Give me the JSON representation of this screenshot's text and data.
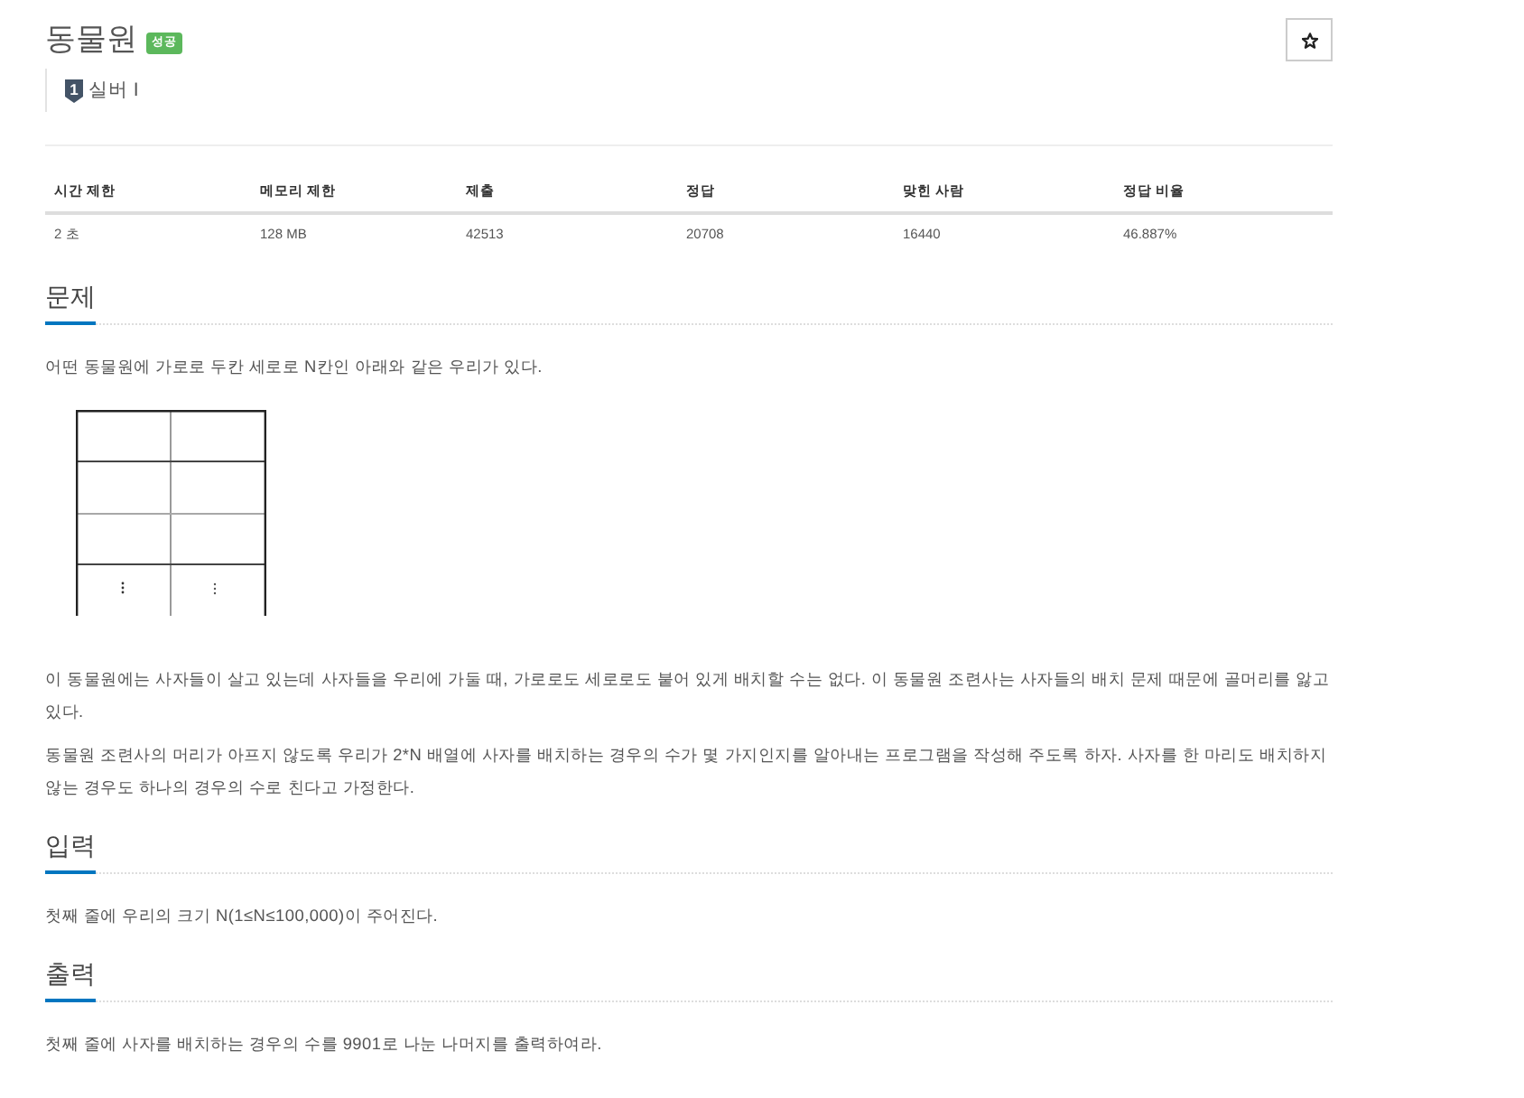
{
  "problem": {
    "title": "동물원",
    "result_badge": "성공",
    "starred": false,
    "tier": {
      "icon_number": "1",
      "label": "실버 I"
    }
  },
  "stats_table": {
    "columns": [
      "시간 제한",
      "메모리 제한",
      "제출",
      "정답",
      "맞힌 사람",
      "정답 비율"
    ],
    "rows": [
      [
        "2 초",
        "128 MB",
        "42513",
        "20708",
        "16440",
        "46.887%"
      ]
    ]
  },
  "sections": [
    {
      "heading": "문제",
      "blocks": [
        {
          "kind": "paragraph",
          "text": "어떤 동물원에 가로로 두칸 세로로 N칸인 아래와 같은 우리가 있다."
        },
        {
          "kind": "cage_diagram"
        },
        {
          "kind": "paragraph",
          "text": "이 동물원에는 사자들이 살고 있는데 사자들을 우리에 가둘 때, 가로로도 세로로도 붙어 있게 배치할 수는 없다. 이 동물원 조련사는 사자들의 배치 문제 때문에 골머리를 앓고 있다."
        },
        {
          "kind": "paragraph",
          "text": "동물원 조련사의 머리가 아프지 않도록 우리가 2*N 배열에 사자를 배치하는 경우의 수가 몇 가지인지를 알아내는 프로그램을 작성해 주도록 하자. 사자를 한 마리도 배치하지 않는 경우도 하나의 경우의 수로 친다고 가정한다."
        }
      ]
    },
    {
      "heading": "입력",
      "blocks": [
        {
          "kind": "paragraph",
          "text": "첫째 줄에 우리의 크기 N(1≤N≤100,000)이 주어진다."
        }
      ]
    },
    {
      "heading": "출력",
      "blocks": [
        {
          "kind": "paragraph",
          "text": "첫째 줄에 사자를 배치하는 경우의 수를 9901로 나눈 나머지를 출력하여라."
        }
      ]
    }
  ]
}
